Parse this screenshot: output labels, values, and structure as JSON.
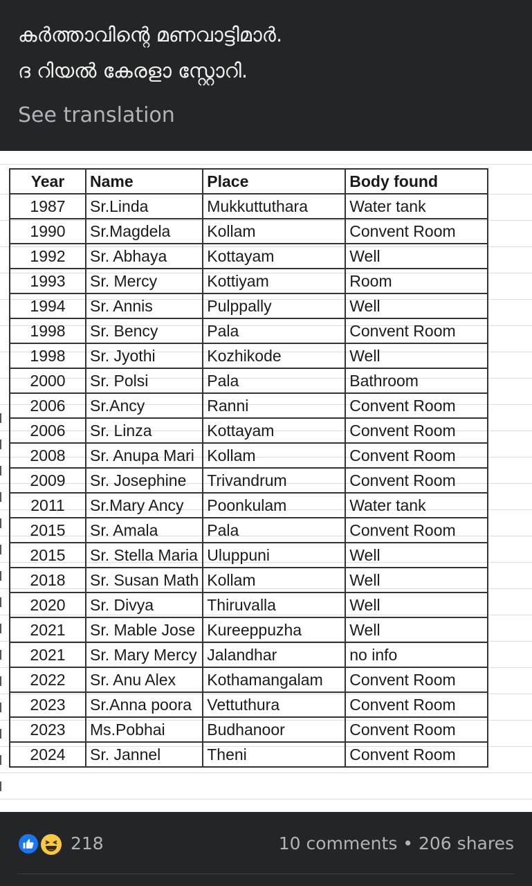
{
  "post": {
    "line1": "കർത്താവിന്റെ മണവാട്ടിമാർ.",
    "line2": "ദ റിയൽ കേരളാ സ്റ്റോറി.",
    "see_translation": "See translation"
  },
  "table": {
    "headers": [
      "Year",
      "Name",
      "Place",
      "Body found"
    ],
    "rows": [
      [
        "1987",
        "Sr.Linda",
        "Mukkuttuthara",
        "Water tank"
      ],
      [
        "1990",
        "Sr.Magdela",
        "Kollam",
        "Convent Room"
      ],
      [
        "1992",
        "Sr. Abhaya",
        "Kottayam",
        "Well"
      ],
      [
        "1993",
        "Sr. Mercy",
        "Kottiyam",
        "Room"
      ],
      [
        "1994",
        "Sr. Annis",
        "Pulppally",
        "Well"
      ],
      [
        "1998",
        "Sr. Bency",
        "Pala",
        "Convent Room"
      ],
      [
        "1998",
        "Sr. Jyothi",
        "Kozhikode",
        "Well"
      ],
      [
        "2000",
        "Sr. Polsi",
        "Pala",
        "Bathroom"
      ],
      [
        "2006",
        "Sr.Ancy",
        "Ranni",
        "Convent Room"
      ],
      [
        "2006",
        "Sr. Linza",
        "Kottayam",
        "Convent Room"
      ],
      [
        "2008",
        "Sr. Anupa Mari",
        "Kollam",
        "Convent Room"
      ],
      [
        "2009",
        "Sr. Josephine",
        "Trivandrum",
        "Convent Room"
      ],
      [
        "2011",
        "Sr.Mary Ancy",
        "Poonkulam",
        "Water tank"
      ],
      [
        "2015",
        "Sr. Amala",
        "Pala",
        "Convent Room"
      ],
      [
        "2015",
        "Sr. Stella Maria",
        "Uluppuni",
        "Well"
      ],
      [
        "2018",
        "Sr. Susan Math",
        "Kollam",
        "Well"
      ],
      [
        "2020",
        "Sr. Divya",
        "Thiruvalla",
        "Well"
      ],
      [
        "2021",
        "Sr. Mable Jose",
        "Kureeppuzha",
        "Well"
      ],
      [
        "2021",
        "Sr. Mary Mercy",
        "Jalandhar",
        "no info"
      ],
      [
        "2022",
        "Sr. Anu Alex",
        "Kothamangalam",
        "Convent Room"
      ],
      [
        "2023",
        "Sr.Anna poora",
        "Vettuthura",
        "Convent Room"
      ],
      [
        "2023",
        "Ms.Pobhai",
        "Budhanoor",
        "Convent Room"
      ],
      [
        "2024",
        "Sr. Jannel",
        "Theni",
        "Convent Room"
      ]
    ]
  },
  "footer": {
    "reaction_count": "218",
    "comments": "10 comments",
    "separator": "•",
    "shares": "206 shares",
    "icons": [
      "like-icon",
      "haha-icon"
    ]
  },
  "colors": {
    "background": "#242526",
    "text_secondary": "#b0b3b8",
    "like_blue": "#1877f2",
    "haha_yellow": "#f7c93e"
  }
}
